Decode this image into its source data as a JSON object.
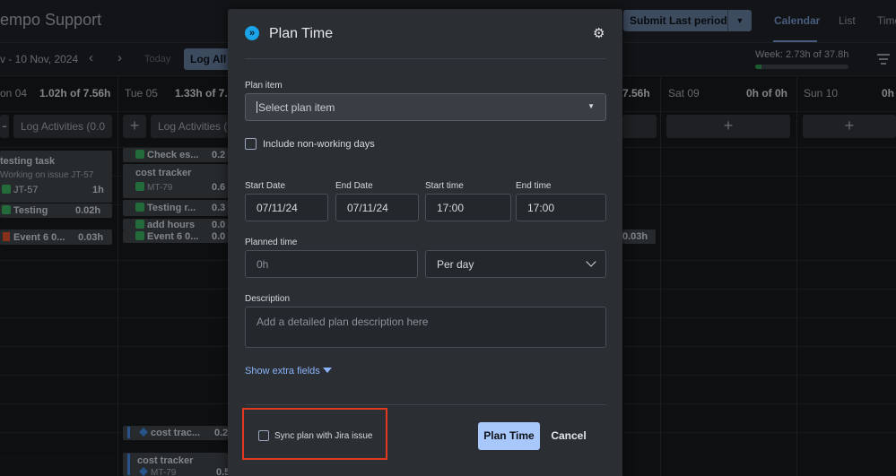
{
  "app": {
    "title": "empo Support",
    "submit_label": "Submit Last period",
    "views": [
      "Calendar",
      "List",
      "Time"
    ],
    "date_range": "v - 10 Nov, 2024",
    "today_label": "Today",
    "log_all_label": "Log All A",
    "week_total": "Week: 2.73h of 37.8h",
    "week_progress": 0.07
  },
  "days": [
    {
      "name": "on",
      "num": "04",
      "hours": "1.02h of 7.56h"
    },
    {
      "name": "Tue",
      "num": "05",
      "hours": "1.33h of 7.5"
    },
    {
      "name": "",
      "num": "",
      "hours": "7.56h"
    },
    {
      "name": "Sat",
      "num": "09",
      "hours": "0h of 0h"
    },
    {
      "name": "Sun",
      "num": "10",
      "hours": "0h"
    }
  ],
  "day_actions": {
    "log_activities_mon": "Log Activities (0.0",
    "log_activities_tue": "Log Activities (",
    "plus": "+"
  },
  "entries": {
    "mon": [
      {
        "title": "testing task",
        "sub": "Working on issue JT-57",
        "key": "JT-57",
        "dur": "1h"
      },
      {
        "title": "Testing",
        "dur": "0.02h"
      },
      {
        "title": "Event 6 0...",
        "dur": "0.03h"
      }
    ],
    "tue": [
      {
        "title": "Check es...",
        "dur": "0.2"
      },
      {
        "title": "cost tracker",
        "key": "MT-79",
        "dur": "0.6"
      },
      {
        "title": "Testing r...",
        "dur": "0.3"
      },
      {
        "title": "add hours",
        "dur": "0.0"
      },
      {
        "title": "Event 6 0...",
        "dur": "0.0"
      },
      {
        "title": "cost trac...",
        "dur": "0.2"
      },
      {
        "title": "cost tracker",
        "key": "MT-79",
        "dur": "0.5"
      }
    ],
    "fri_partial": "0.03h"
  },
  "modal": {
    "title": "Plan Time",
    "plan_item_label": "Plan item",
    "plan_item_placeholder": "Select plan item",
    "include_nonworking_label": "Include non-working days",
    "start_date_label": "Start Date",
    "start_date_value": "07/11/24",
    "end_date_label": "End Date",
    "end_date_value": "07/11/24",
    "start_time_label": "Start time",
    "start_time_value": "17:00",
    "end_time_label": "End time",
    "end_time_value": "17:00",
    "planned_time_label": "Planned time",
    "planned_time_placeholder": "0h",
    "period_value": "Per day",
    "description_label": "Description",
    "description_placeholder": "Add a detailed plan description here",
    "extra_fields_link": "Show extra fields",
    "sync_label": "Sync plan with Jira issue",
    "plan_button": "Plan Time",
    "cancel_button": "Cancel"
  },
  "colors": {
    "accent": "#a8c7fa",
    "highlight": "#e0391f",
    "brand": "#1aa3e8"
  }
}
